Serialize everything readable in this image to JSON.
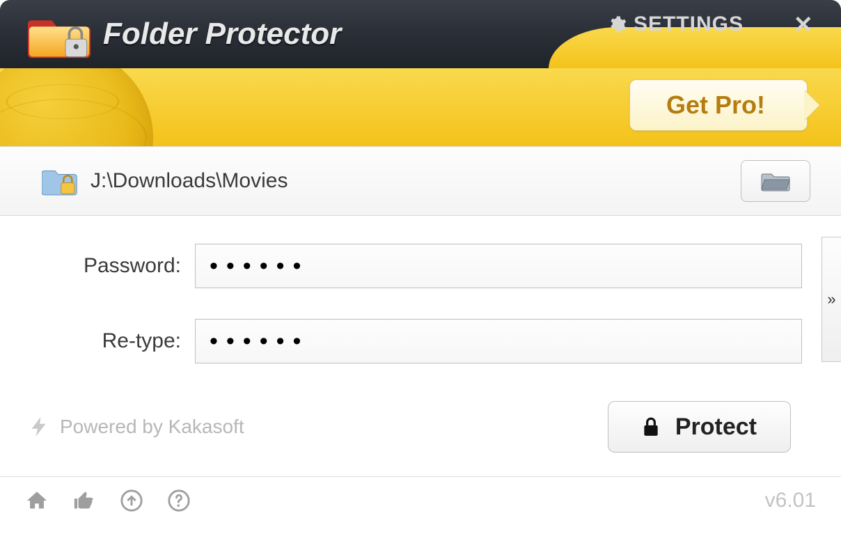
{
  "header": {
    "app_title": "Folder Protector",
    "settings_label": "SETTINGS",
    "close_label": "✕"
  },
  "banner": {
    "get_pro_label": "Get Pro!"
  },
  "path": {
    "value": "J:\\Downloads\\Movies"
  },
  "form": {
    "password_label": "Password:",
    "password_value": "••••••",
    "retype_label": "Re-type:",
    "retype_value": "••••••",
    "expand_label": "»"
  },
  "action": {
    "powered_label": "Powered by Kakasoft",
    "protect_label": "Protect"
  },
  "footer": {
    "version": "v6.01"
  }
}
